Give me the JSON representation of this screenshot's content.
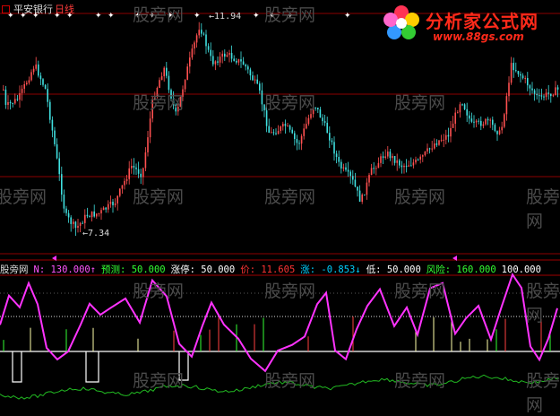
{
  "header": {
    "stock_name": "平安银行",
    "period": "日线"
  },
  "logo": {
    "name": "分析家公式网",
    "url": "www.88gs.com"
  },
  "watermark": "股旁网",
  "price_labels": {
    "high": "11.94",
    "low": "7.34"
  },
  "indicator": {
    "name": "股旁网",
    "items": [
      {
        "label": "N:",
        "value": "130.000",
        "arrow": "↑",
        "color": "#ff55ff"
      },
      {
        "label": "预测:",
        "value": "50.000",
        "arrow": "",
        "color": "#33ff33"
      },
      {
        "label": "涨停:",
        "value": "50.000",
        "arrow": "",
        "color": "#ffffff"
      },
      {
        "label": "价:",
        "value": "11.605",
        "arrow": "",
        "color": "#ff3333"
      },
      {
        "label": "涨:",
        "value": "-0.853",
        "arrow": "↓",
        "color": "#00d0ff"
      },
      {
        "label": "低:",
        "value": "50.000",
        "arrow": "",
        "color": "#ffffff"
      },
      {
        "label": "风险:",
        "value": "160.000",
        "arrow": "",
        "color": "#33ff33"
      },
      {
        "label": "",
        "value": "100.000",
        "arrow": "",
        "color": "#ffffff"
      }
    ]
  },
  "colors": {
    "up": "#ff5050",
    "down": "#40e0e0",
    "grid": "#8b0000",
    "n_line": "#ff33ff",
    "green_line": "#22bb22"
  }
}
